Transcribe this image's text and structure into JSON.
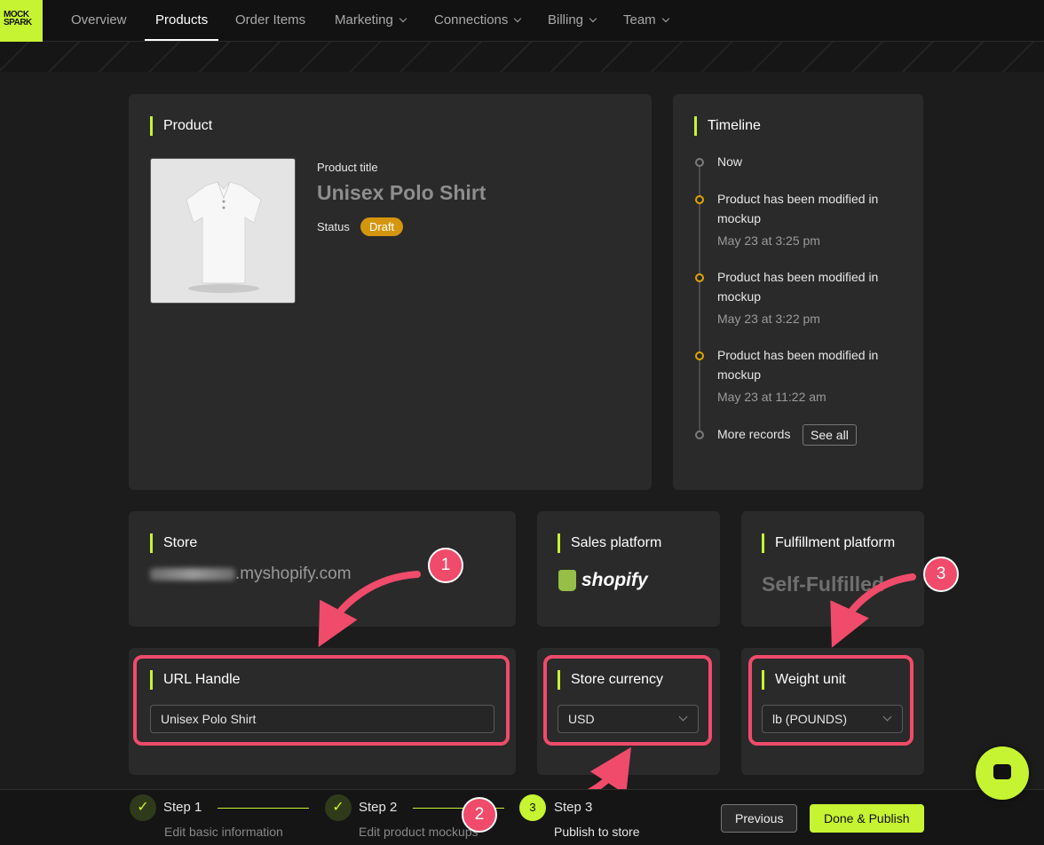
{
  "brand": {
    "logo_text": "MOCK SPARK",
    "accent": "#c6f432"
  },
  "nav": {
    "items": [
      {
        "label": "Overview"
      },
      {
        "label": "Products"
      },
      {
        "label": "Order Items"
      },
      {
        "label": "Marketing"
      },
      {
        "label": "Connections"
      },
      {
        "label": "Billing"
      },
      {
        "label": "Team"
      }
    ],
    "active": "Products"
  },
  "product": {
    "section_title": "Product",
    "title_label": "Product title",
    "title": "Unisex Polo Shirt",
    "status_label": "Status",
    "status": "Draft"
  },
  "timeline": {
    "section_title": "Timeline",
    "now": "Now",
    "events": [
      {
        "text": "Product has been modified in mockup",
        "time": "May 23 at 3:25 pm"
      },
      {
        "text": "Product has been modified in mockup",
        "time": "May 23 at 3:22 pm"
      },
      {
        "text": "Product has been modified in mockup",
        "time": "May 23 at 11:22 am"
      }
    ],
    "more_label": "More records",
    "see_all": "See all"
  },
  "store": {
    "section_title": "Store",
    "domain_suffix": ".myshopify.com"
  },
  "sales_platform": {
    "section_title": "Sales platform",
    "name": "shopify"
  },
  "fulfillment": {
    "section_title": "Fulfillment platform",
    "name": "Self-Fulfilled"
  },
  "url_handle": {
    "section_title": "URL Handle",
    "value": "Unisex Polo Shirt"
  },
  "currency": {
    "section_title": "Store currency",
    "value": "USD"
  },
  "weight": {
    "section_title": "Weight unit",
    "value": "lb (POUNDS)"
  },
  "annotations": [
    "1",
    "2",
    "3"
  ],
  "steps": [
    {
      "label": "Step 1",
      "sub": "Edit basic information",
      "state": "done"
    },
    {
      "label": "Step 2",
      "sub": "Edit product mockups",
      "state": "done"
    },
    {
      "label": "Step 3",
      "sub": "Publish to store",
      "state": "current",
      "num": "3"
    }
  ],
  "buttons": {
    "previous": "Previous",
    "done": "Done & Publish"
  }
}
